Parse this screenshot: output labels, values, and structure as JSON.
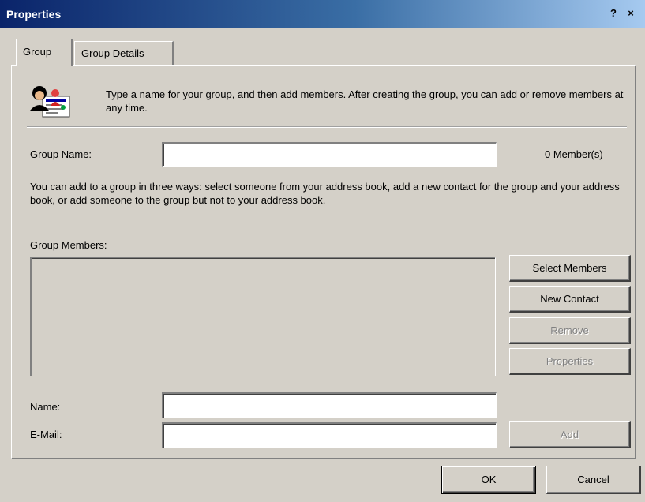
{
  "window": {
    "title": "Properties",
    "help_glyph": "?",
    "close_glyph": "×"
  },
  "tabs": [
    {
      "label": "Group",
      "selected": true
    },
    {
      "label": "Group Details",
      "selected": false
    }
  ],
  "intro": {
    "icon": "group-people-icon",
    "text": "Type a name for your group, and then add members. After creating the group, you can add or remove members at any time."
  },
  "group_name": {
    "label": "Group Name:",
    "value": "",
    "member_count": "0 Member(s)"
  },
  "description": "You can add to a group in three ways: select someone from your address book, add a new contact for the group and your address book, or add someone to the group but not to your address book.",
  "members": {
    "label": "Group Members:",
    "items": []
  },
  "side_buttons": {
    "select_members": "Select Members",
    "new_contact": "New Contact",
    "remove": "Remove",
    "properties": "Properties"
  },
  "new_entry": {
    "name_label": "Name:",
    "name_value": "",
    "email_label": "E-Mail:",
    "email_value": "",
    "add_label": "Add"
  },
  "footer": {
    "ok": "OK",
    "cancel": "Cancel"
  },
  "colors": {
    "face": "#d4d0c8",
    "title_start": "#0a246a",
    "title_end": "#a6caf0"
  }
}
